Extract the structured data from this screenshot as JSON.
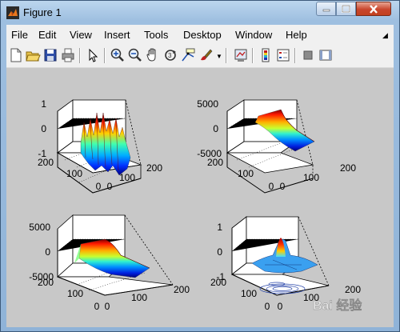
{
  "window": {
    "title": "Figure 1"
  },
  "menu": [
    "File",
    "Edit",
    "View",
    "Insert",
    "Tools",
    "Desktop",
    "Window",
    "Help"
  ],
  "toolbar": [
    "new-figure",
    "open-file",
    "save",
    "print",
    "edit-plot",
    "zoom-in",
    "zoom-out",
    "pan",
    "rotate-3d",
    "data-cursor",
    "brush",
    "link-plot",
    "insert-colorbar",
    "insert-legend",
    "hide-plot-tools",
    "show-plot-tools"
  ],
  "subplots": [
    {
      "z_ticks": [
        "1",
        "0",
        "-1"
      ],
      "x_ticks": [
        "0",
        "100",
        "200"
      ],
      "y_ticks": [
        "0",
        "100",
        "200"
      ]
    },
    {
      "z_ticks": [
        "5000",
        "0",
        "-5000"
      ],
      "x_ticks": [
        "0",
        "100",
        "200"
      ],
      "y_ticks": [
        "0",
        "100",
        "200"
      ]
    },
    {
      "z_ticks": [
        "5000",
        "0",
        "-5000"
      ],
      "x_ticks": [
        "0",
        "100",
        "200"
      ],
      "y_ticks": [
        "0",
        "100",
        "200"
      ]
    },
    {
      "z_ticks": [
        "1",
        "0",
        "-1"
      ],
      "x_ticks": [
        "0",
        "100",
        "200"
      ],
      "y_ticks": [
        "0",
        "100",
        "200"
      ]
    }
  ],
  "watermark": "Bai 经验"
}
